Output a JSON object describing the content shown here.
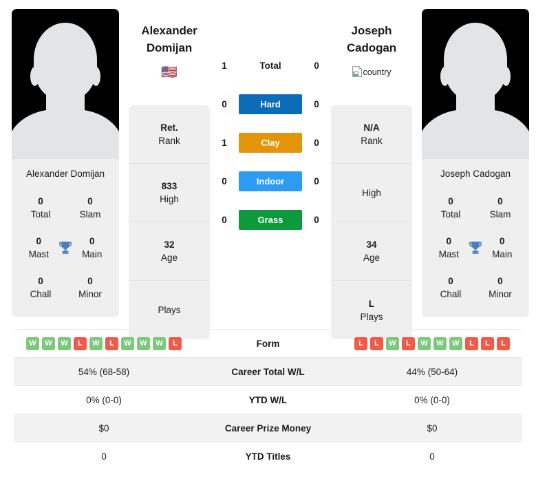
{
  "players": {
    "left": {
      "first_name": "Alexander",
      "last_name": "Domijan",
      "full_name": "Alexander Domijan",
      "flag": "🇺🇸",
      "flag_name": "us-flag",
      "rank": "Ret.",
      "rank_label": "Rank",
      "high": "833",
      "high_label": "High",
      "age": "32",
      "age_label": "Age",
      "plays": "",
      "plays_label": "Plays",
      "titles": {
        "total": "0",
        "total_label": "Total",
        "slam": "0",
        "slam_label": "Slam",
        "mast": "0",
        "mast_label": "Mast",
        "main": "0",
        "main_label": "Main",
        "chall": "0",
        "chall_label": "Chall",
        "minor": "0",
        "minor_label": "Minor"
      }
    },
    "right": {
      "first_name": "Joseph",
      "last_name": "Cadogan",
      "full_name": "Joseph Cadogan",
      "flag_alt": "country",
      "flag_name": "broken-country-flag",
      "rank": "N/A",
      "rank_label": "Rank",
      "high": "",
      "high_label": "High",
      "age": "34",
      "age_label": "Age",
      "plays": "L",
      "plays_label": "Plays",
      "titles": {
        "total": "0",
        "total_label": "Total",
        "slam": "0",
        "slam_label": "Slam",
        "mast": "0",
        "mast_label": "Mast",
        "main": "0",
        "main_label": "Main",
        "chall": "0",
        "chall_label": "Chall",
        "minor": "0",
        "minor_label": "Minor"
      }
    }
  },
  "surfaces": [
    {
      "label": "Total",
      "left": "1",
      "right": "0",
      "color": "transparent",
      "plain": true
    },
    {
      "label": "Hard",
      "left": "0",
      "right": "0",
      "color": "#0B6DB7",
      "plain": false
    },
    {
      "label": "Clay",
      "left": "1",
      "right": "0",
      "color": "#E39407",
      "plain": false
    },
    {
      "label": "Indoor",
      "left": "0",
      "right": "0",
      "color": "#2B9BF4",
      "plain": false
    },
    {
      "label": "Grass",
      "left": "0",
      "right": "0",
      "color": "#0C9A3C",
      "plain": false
    }
  ],
  "form": {
    "label": "Form",
    "left": [
      "W",
      "W",
      "W",
      "L",
      "W",
      "L",
      "W",
      "W",
      "W",
      "L"
    ],
    "right": [
      "L",
      "L",
      "W",
      "L",
      "W",
      "W",
      "W",
      "L",
      "L",
      "L"
    ],
    "win_color": "#7DC87D",
    "loss_color": "#EF5B4A"
  },
  "comparison_rows": [
    {
      "label": "Career Total W/L",
      "left": "54% (68-58)",
      "right": "44% (50-64)"
    },
    {
      "label": "YTD W/L",
      "left": "0% (0-0)",
      "right": "0% (0-0)"
    },
    {
      "label": "Career Prize Money",
      "left": "$0",
      "right": "$0"
    },
    {
      "label": "YTD Titles",
      "left": "0",
      "right": "0"
    }
  ],
  "colors": {
    "card_bg": "#EFEFEF",
    "alt_row": "#F2F2F2",
    "trophy": "#4A7EBB",
    "photo_bg": "#000000"
  }
}
